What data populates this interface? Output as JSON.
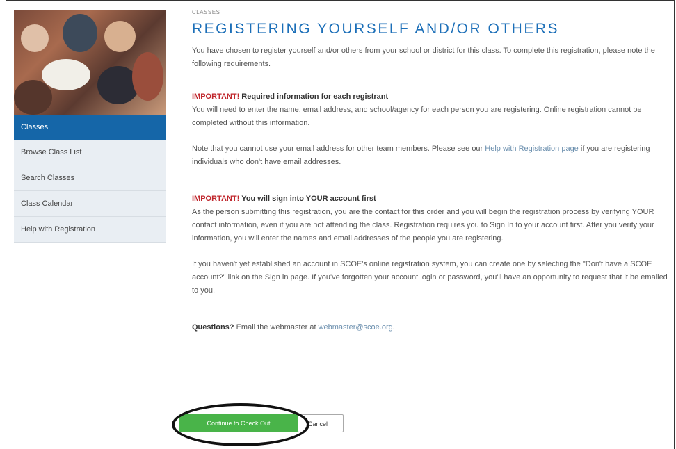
{
  "breadcrumb": "CLASSES",
  "title": "REGISTERING YOURSELF AND/OR OTHERS",
  "intro": "You have chosen to register yourself and/or others from your school or district for this class. To complete this registration, please note the following requirements.",
  "section1": {
    "flag": "IMPORTANT!",
    "heading": "Required information for each registrant",
    "body": "You will need to enter the name, email address, and school/agency for each person you are registering. Online registration cannot be completed without this information.",
    "note_before": "Note that you cannot use your email address for other team members. Please see our ",
    "note_link": "Help with Registration page",
    "note_after": " if you are registering individuals who don't have email addresses."
  },
  "section2": {
    "flag": "IMPORTANT!",
    "heading": "You will sign into YOUR account first",
    "body": "As the person submitting this registration, you are the contact for this order and you will begin the registration process by verifying YOUR contact information, even if you are not attending the class. Registration requires you to Sign In to your account first. After you verify your information, you will enter the names and email addresses of the people you are registering.",
    "body2": "If you haven't yet established an account in SCOE's online registration system, you can create one by selecting the \"Don't have a SCOE account?\" link on the Sign in page. If you've forgotten your account login or password, you'll have an opportunity to request that it be emailed to you."
  },
  "questions": {
    "label": "Questions?",
    "text": " Email the webmaster at ",
    "email": "webmaster@scoe.org",
    "end": "."
  },
  "buttons": {
    "primary": "Continue to Check Out",
    "secondary": "Cancel"
  },
  "sidebar": {
    "items": [
      {
        "label": "Classes"
      },
      {
        "label": "Browse Class List"
      },
      {
        "label": "Search Classes"
      },
      {
        "label": "Class Calendar"
      },
      {
        "label": "Help with Registration"
      }
    ]
  },
  "colors": {
    "accent": "#1c6fb8",
    "important": "#c0272d",
    "primary_button": "#49b449",
    "active_nav": "#1566a8"
  }
}
